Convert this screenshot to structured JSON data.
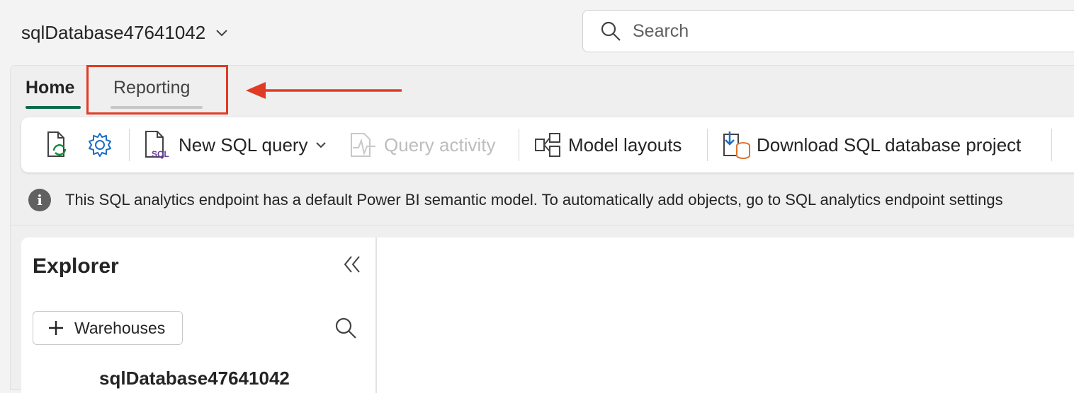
{
  "header": {
    "db_name": "sqlDatabase47641042",
    "search_placeholder": "Search"
  },
  "tabs": [
    {
      "label": "Home",
      "active": true
    },
    {
      "label": "Reporting",
      "active": false
    }
  ],
  "toolbar": {
    "new_sql_query": "New SQL query",
    "query_activity": "Query activity",
    "model_layouts": "Model layouts",
    "download_project": "Download SQL database project"
  },
  "info": {
    "message": "This SQL analytics endpoint has a default Power BI semantic model. To automatically add objects, go to SQL analytics endpoint settings"
  },
  "explorer": {
    "title": "Explorer",
    "add_button_label": "Warehouses",
    "tree_item": "sqlDatabase47641042"
  },
  "colors": {
    "accent_underline": "#0f6b4e",
    "highlight": "#e03b24"
  }
}
